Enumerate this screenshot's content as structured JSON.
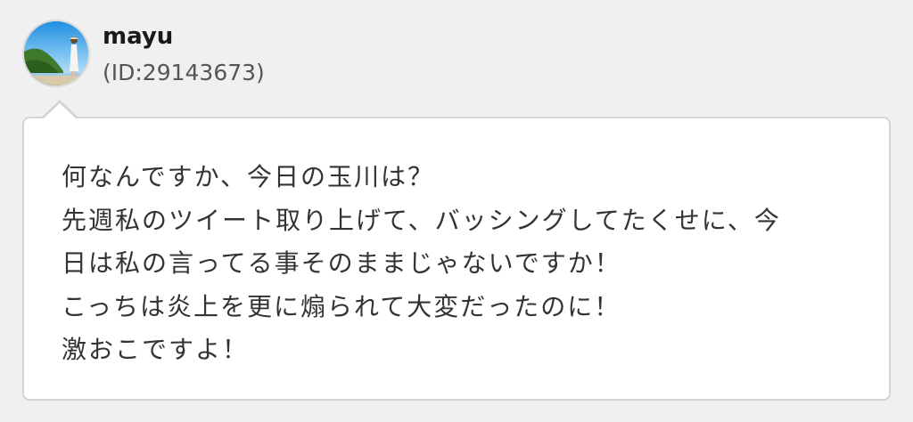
{
  "user": {
    "name": "mayu",
    "id_text": "(ID:29143673)",
    "avatar_icon": "avatar-photo"
  },
  "message": {
    "lines": [
      "何なんですか、今日の玉川は？",
      "先週私のツイート取り上げて、バッシングしてたくせに、今",
      "日は私の言ってる事そのままじゃないですか！",
      "こっちは炎上を更に煽られて大変だったのに！",
      "激おこですよ！"
    ]
  },
  "colors": {
    "background": "#f0f0f0",
    "bubble": "#ffffff",
    "bubble_border": "#d4d4d4",
    "text": "#333333"
  }
}
